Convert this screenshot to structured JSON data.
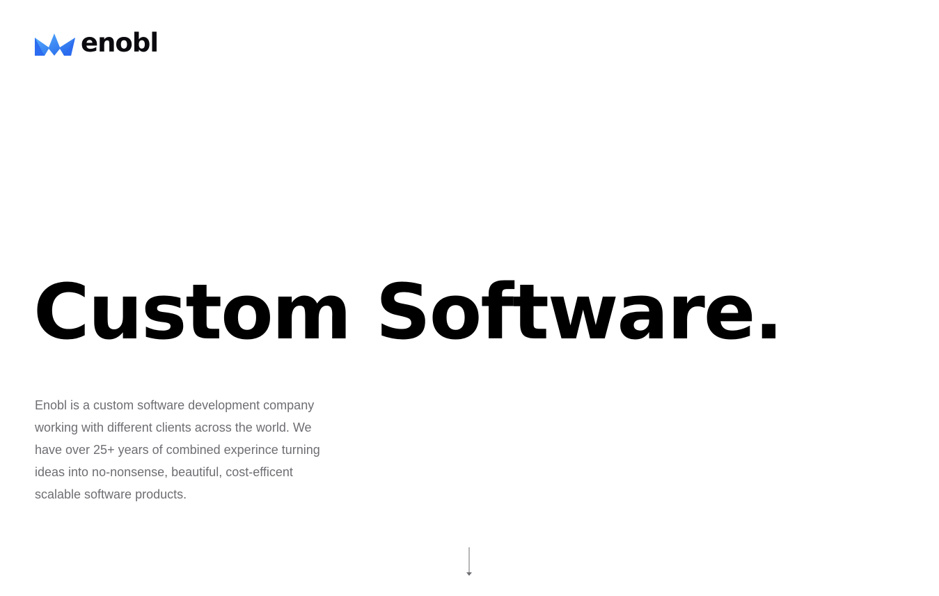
{
  "brand": {
    "name": "enobl",
    "logo_icon": "crown-icon",
    "colors": {
      "accent_light": "#4aa3ff",
      "accent_dark": "#1f5fe8",
      "text": "#0b0b0f"
    }
  },
  "hero": {
    "title": "Custom Software.",
    "description": "Enobl is a custom software development company working with different clients across the world. We have over 25+ years of combined experince turning ideas into no-nonsense, beautiful, cost-efficent scalable software products."
  },
  "scroll_indicator": {
    "icon": "arrow-down-icon",
    "color": "#6e6e73"
  }
}
